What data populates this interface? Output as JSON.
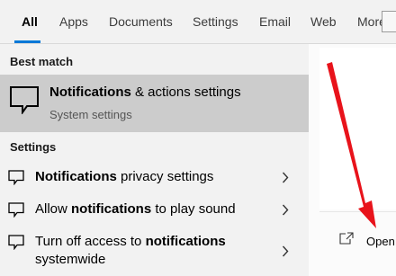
{
  "tabs": [
    {
      "label": "All",
      "active": true
    },
    {
      "label": "Apps"
    },
    {
      "label": "Documents"
    },
    {
      "label": "Settings"
    },
    {
      "label": "Email"
    },
    {
      "label": "Web"
    },
    {
      "label": "More"
    }
  ],
  "sections": {
    "best_match": "Best match",
    "settings": "Settings"
  },
  "best_match": {
    "title_bold": "Notifications",
    "title_rest": " & actions settings",
    "subtitle": "System settings",
    "icon": "notification-speech-bubble-icon"
  },
  "results": [
    {
      "pre": "",
      "bold": "Notifications",
      "post": " privacy settings",
      "icon": "notification-speech-bubble-icon"
    },
    {
      "pre": "Allow ",
      "bold": "notifications",
      "post": " to play sound",
      "icon": "notification-speech-bubble-icon"
    },
    {
      "pre": "Turn off access to ",
      "bold": "notifications",
      "post": " systemwide",
      "icon": "notification-speech-bubble-icon"
    }
  ],
  "preview": {
    "open_label": "Open",
    "open_icon": "open-external-icon"
  },
  "colors": {
    "accent": "#0078d7",
    "selected_bg": "#cccccc",
    "panel_bg": "#f2f2f2",
    "annotation_arrow": "#e8131b"
  }
}
